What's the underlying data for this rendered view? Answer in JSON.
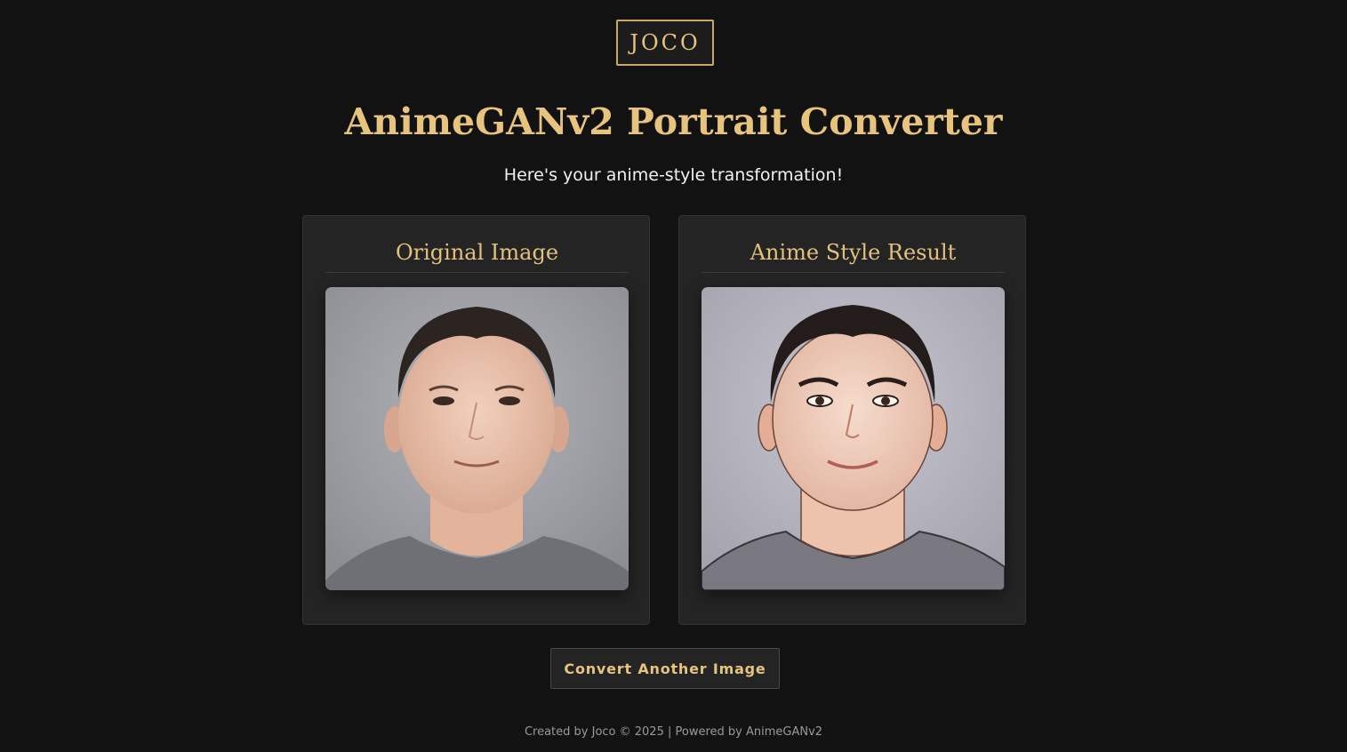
{
  "header": {
    "logo_text": "JOCO",
    "title": "AnimeGANv2 Portrait Converter",
    "subtitle": "Here's your anime-style transformation!"
  },
  "results": {
    "original": {
      "heading": "Original Image",
      "image_alt": "photo-portrait"
    },
    "anime": {
      "heading": "Anime Style Result",
      "image_alt": "anime-portrait"
    }
  },
  "actions": {
    "convert_another_label": "Convert Another Image"
  },
  "footer": {
    "text": "Created by Joco © 2025 | Powered by AnimeGANv2"
  },
  "colors": {
    "background": "#121212",
    "card": "#242424",
    "accent_gold": "#e8c37e",
    "text_light": "#f2f2f2",
    "text_muted": "#9a9a9a"
  }
}
